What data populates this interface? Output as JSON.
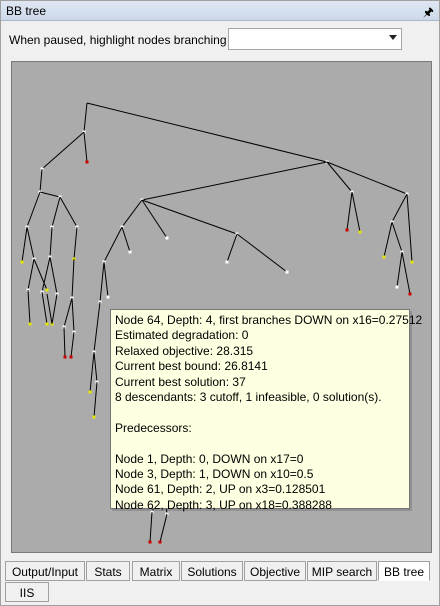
{
  "window": {
    "title": "BB tree",
    "pin_glyph": "🖈"
  },
  "toolbar": {
    "highlight_label": "When paused, highlight nodes branching on",
    "highlight_value": ""
  },
  "tooltip": {
    "lines": [
      "Node 64, Depth: 4, first branches DOWN on x16=0.27512",
      "Estimated degradation: 0",
      "Relaxed objective: 28.315",
      "Current best bound: 26.8141",
      "Current best solution: 37",
      "8 descendants: 3 cutoff, 1 infeasible, 0 solution(s).",
      "",
      "Predecessors:",
      "",
      "Node 1, Depth: 0, DOWN on x17=0",
      "Node 3, Depth: 1, DOWN on x10=0.5",
      "Node 61, Depth: 2, UP on x3=0.128501",
      "Node 62, Depth: 3, UP on x18=0.388288"
    ]
  },
  "tabs": [
    {
      "label": "Output/Input"
    },
    {
      "label": "Stats"
    },
    {
      "label": "Matrix"
    },
    {
      "label": "Solutions"
    },
    {
      "label": "Objective"
    },
    {
      "label": "MIP search"
    },
    {
      "label": "BB tree",
      "active": true
    },
    {
      "label": "IIS"
    }
  ],
  "colors": {
    "canvas": "#ababab",
    "node_leaf_red": "#cc0000",
    "node_leaf_yellow": "#e6e600",
    "node_root": "#2bb52b",
    "edge": "#000000"
  }
}
